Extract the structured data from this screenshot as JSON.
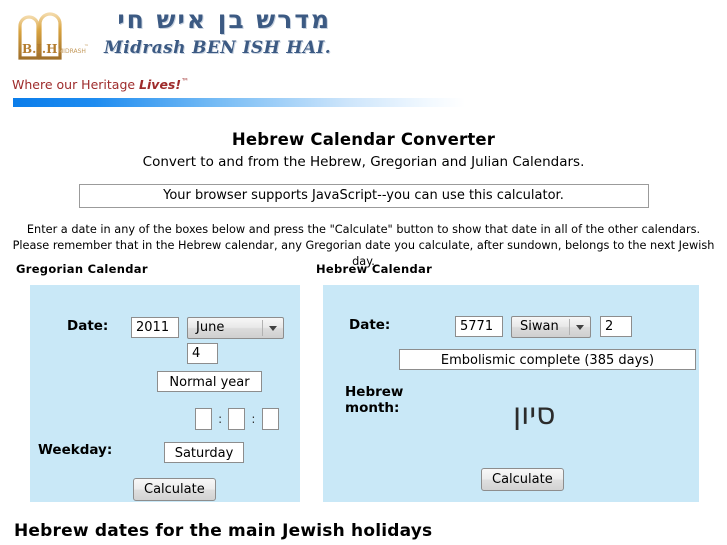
{
  "header": {
    "hebrew_title": "מדרש בן איש חי",
    "english_title": "Midrash BEN ISH HAI.",
    "tagline_prefix": "Where our Heritage ",
    "tagline_emphasis": "Lives!",
    "tagline_tm": "™",
    "logo_icon": "tablets-logo-icon",
    "logo_text": "B.I.H.",
    "accent_blue": "#0b7dea",
    "title_color": "#3c5a83",
    "tagline_color": "#9e2b2b"
  },
  "converter": {
    "title": "Hebrew Calendar Converter",
    "subtitle": "Convert to and from the Hebrew, Gregorian and Julian Calendars.",
    "js_notice": "Your browser supports JavaScript--you can use this calculator.",
    "instructions_line1": "Enter a date in any of the boxes below and press the \"Calculate\" button to show that date in all of the other calendars.",
    "instructions_line2": "Please remember that in the Hebrew calendar, any Gregorian date you calculate, after sundown, belongs to the next Jewish day."
  },
  "gregorian": {
    "heading": "Gregorian Calendar",
    "date_label": "Date:",
    "year": "2011",
    "month": "June",
    "day": "4",
    "year_type": "Normal year",
    "hour": "",
    "minute": "",
    "second": "",
    "time_separator": ":",
    "weekday_label": "Weekday:",
    "weekday": "Saturday",
    "calculate_label": "Calculate",
    "panel_color": "#c9e8f7"
  },
  "hebrew": {
    "heading": "Hebrew Calendar",
    "date_label": "Date:",
    "year": "5771",
    "month": "Siwan",
    "day": "2",
    "year_type": "Embolismic complete (385 days)",
    "month_label_line1": "Hebrew",
    "month_label_line2": "month:",
    "month_hebrew": "סיון",
    "calculate_label": "Calculate",
    "panel_color": "#c9e8f7"
  },
  "footer": {
    "holidays_heading": "Hebrew dates for the main Jewish holidays"
  }
}
